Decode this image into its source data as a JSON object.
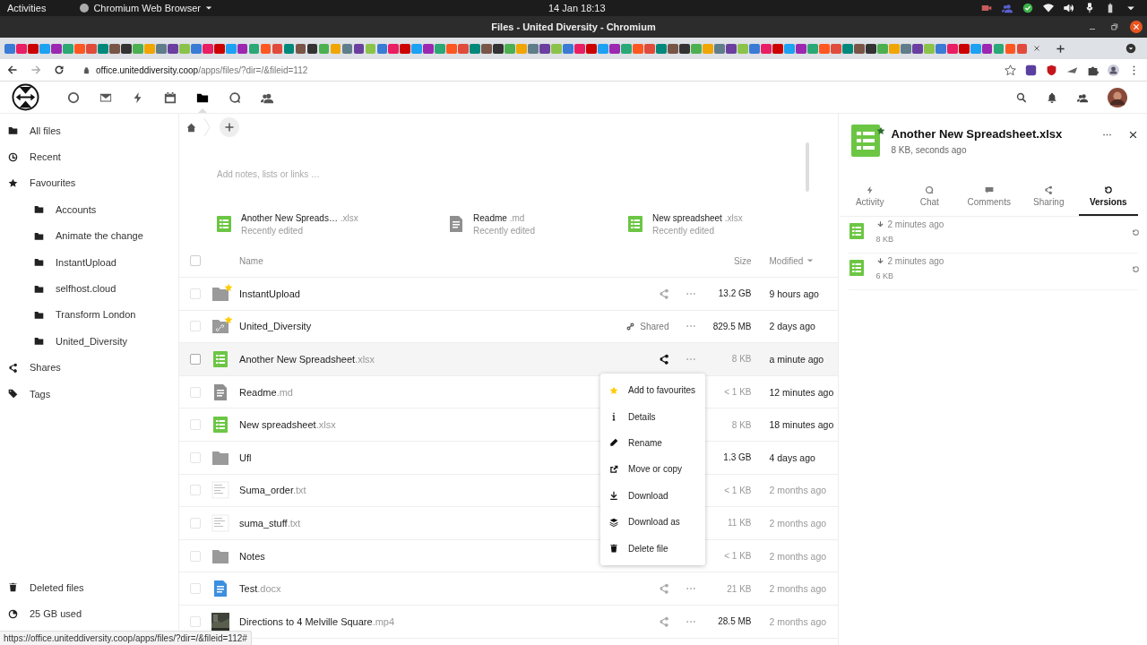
{
  "system_bar": {
    "activities": "Activities",
    "app_menu": "Chromium Web Browser",
    "clock": "14 Jan  18:13"
  },
  "window": {
    "title": "Files - United Diversity - Chromium"
  },
  "address_bar": {
    "domain": "office.uniteddiversity.coop",
    "path": "/apps/files/?dir=/&fileid=112"
  },
  "apps": [
    {
      "kind": "dashboard",
      "selected": false
    },
    {
      "kind": "mail",
      "selected": false
    },
    {
      "kind": "bolt",
      "selected": false
    },
    {
      "kind": "calendar",
      "selected": false
    },
    {
      "kind": "folder",
      "selected": true
    },
    {
      "kind": "chat",
      "selected": false
    },
    {
      "kind": "contacts",
      "selected": false
    }
  ],
  "sidebar": {
    "items": [
      {
        "label": "All files",
        "kind": "folder"
      },
      {
        "label": "Recent",
        "kind": "clock"
      },
      {
        "label": "Favourites",
        "kind": "star",
        "children": [
          {
            "label": "Accounts"
          },
          {
            "label": "Animate the change"
          },
          {
            "label": "InstantUpload"
          },
          {
            "label": "selfhost.cloud"
          },
          {
            "label": "Transform London"
          },
          {
            "label": "United_Diversity"
          }
        ]
      },
      {
        "label": "Shares",
        "kind": "share"
      },
      {
        "label": "Tags",
        "kind": "tag"
      }
    ],
    "footer": [
      {
        "label": "Deleted files",
        "kind": "trash"
      },
      {
        "label": "25 GB used",
        "kind": "pie"
      }
    ]
  },
  "notes": {
    "placeholder": "Add notes, lists or links …"
  },
  "recent": [
    {
      "name": "Another New Spreads…",
      "ext": ".xlsx",
      "subtitle": "Recently edited",
      "kind": "sheet"
    },
    {
      "name": "Readme",
      "ext": ".md",
      "subtitle": "Recently edited",
      "kind": "doc"
    },
    {
      "name": "New spreadsheet",
      "ext": ".xlsx",
      "subtitle": "Recently edited",
      "kind": "sheet"
    }
  ],
  "table": {
    "select_all_checked": false,
    "columns": {
      "name": "Name",
      "size": "Size",
      "modified": "Modified"
    },
    "rows": [
      {
        "name": "InstantUpload",
        "kind": "folder",
        "favorite": true,
        "checked": false,
        "shared": false,
        "actions_hidden": false,
        "size": "13.2 GB",
        "size_strong": true,
        "modified": "9 hours ago",
        "modified_strong": true,
        "selected": false
      },
      {
        "name": "United_Diversity",
        "kind": "linked-folder",
        "favorite": true,
        "checked": false,
        "shared": true,
        "share_label": "Shared",
        "actions_hidden": false,
        "size": "829.5 MB",
        "size_strong": true,
        "modified": "2 days ago",
        "modified_strong": true,
        "selected": false
      },
      {
        "name": "Another New Spreadsheet",
        "ext": ".xlsx",
        "kind": "sheet",
        "favorite": false,
        "checked": false,
        "shared": false,
        "actions_hidden": false,
        "size": "8 KB",
        "size_strong": false,
        "modified": "a minute ago",
        "modified_strong": true,
        "selected": true
      },
      {
        "name": "Readme",
        "ext": ".md",
        "kind": "doc",
        "favorite": false,
        "checked": false,
        "actions_hidden": true,
        "size": "< 1 KB",
        "size_strong": false,
        "modified": "12 minutes ago",
        "modified_strong": true,
        "selected": false
      },
      {
        "name": "New spreadsheet",
        "ext": ".xlsx",
        "kind": "sheet",
        "favorite": false,
        "checked": false,
        "actions_hidden": true,
        "size": "8 KB",
        "size_strong": false,
        "modified": "18 minutes ago",
        "modified_strong": true,
        "selected": false
      },
      {
        "name": "Ufl",
        "kind": "folder",
        "favorite": false,
        "checked": false,
        "actions_hidden": true,
        "size": "1.3 GB",
        "size_strong": true,
        "modified": "4 days ago",
        "modified_strong": true,
        "selected": false
      },
      {
        "name": "Suma_order",
        "ext": ".txt",
        "kind": "text-thumb",
        "favorite": false,
        "checked": false,
        "actions_hidden": true,
        "size": "< 1 KB",
        "size_strong": false,
        "modified": "2 months ago",
        "modified_strong": false,
        "selected": false
      },
      {
        "name": "suma_stuff",
        "ext": ".txt",
        "kind": "text-thumb",
        "favorite": false,
        "checked": false,
        "actions_hidden": true,
        "size": "11 KB",
        "size_strong": false,
        "modified": "2 months ago",
        "modified_strong": false,
        "selected": false
      },
      {
        "name": "Notes",
        "kind": "folder",
        "favorite": false,
        "checked": false,
        "actions_hidden": true,
        "size": "< 1 KB",
        "size_strong": false,
        "modified": "2 months ago",
        "modified_strong": false,
        "selected": false
      },
      {
        "name": "Test",
        "ext": ".docx",
        "kind": "word",
        "favorite": false,
        "checked": false,
        "shared": false,
        "actions_hidden": false,
        "size": "21 KB",
        "size_strong": false,
        "modified": "2 months ago",
        "modified_strong": false,
        "selected": false
      },
      {
        "name": "Directions to 4 Melville Square",
        "ext": ".mp4",
        "kind": "video",
        "favorite": false,
        "checked": false,
        "shared": false,
        "actions_hidden": false,
        "size": "28.5 MB",
        "size_strong": true,
        "modified": "2 months ago",
        "modified_strong": false,
        "selected": false
      }
    ]
  },
  "context_menu": {
    "items": [
      {
        "label": "Add to favourites",
        "kind": "star"
      },
      {
        "label": "Details",
        "kind": "info"
      },
      {
        "label": "Rename",
        "kind": "pencil"
      },
      {
        "label": "Move or copy",
        "kind": "external"
      },
      {
        "label": "Download",
        "kind": "download"
      },
      {
        "label": "Download as",
        "kind": "layers"
      },
      {
        "label": "Delete file",
        "kind": "trash"
      }
    ]
  },
  "details": {
    "title": "Another New Spreadsheet.xlsx",
    "subtitle": "8 KB, seconds ago",
    "favorite": true,
    "tabs": [
      {
        "label": "Activity",
        "kind": "bolt",
        "selected": false
      },
      {
        "label": "Chat",
        "kind": "chat",
        "selected": false
      },
      {
        "label": "Comments",
        "kind": "comment",
        "selected": false
      },
      {
        "label": "Sharing",
        "kind": "share",
        "selected": false
      },
      {
        "label": "Versions",
        "kind": "restore",
        "selected": true
      }
    ],
    "versions": [
      {
        "time": "2 minutes ago",
        "size": "8 KB"
      },
      {
        "time": "2 minutes ago",
        "size": "6 KB"
      }
    ]
  },
  "status_url": "https://office.uniteddiversity.coop/apps/files/?dir=/&fileid=112#"
}
